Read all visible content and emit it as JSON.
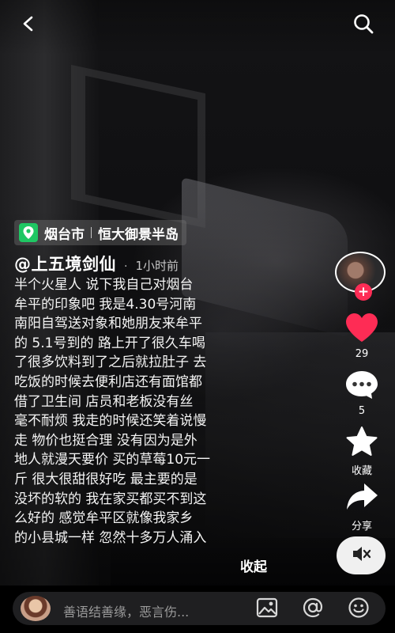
{
  "header": {
    "back_icon": "chevron-left-icon",
    "search_icon": "search-icon"
  },
  "location": {
    "icon": "map-pin-icon",
    "city": "烟台市",
    "place": "恒大御景半岛"
  },
  "post": {
    "author": "@上五境剑仙",
    "separator": "·",
    "time": "1小时前",
    "caption_lines": [
      "半个火星人 说下我自己对烟台",
      "牟平的印象吧  我是4.30号河南",
      "南阳自驾送对象和她朋友来牟平",
      "的 5.1号到的 路上开了很久车喝",
      "了很多饮料到了之后就拉肚子 去",
      "吃饭的时候去便利店还有面馆都",
      "借了卫生间  店员和老板没有丝",
      "毫不耐烦 我走的时候还笑着说慢",
      "走  物价也挺合理 没有因为是外",
      "地人就漫天要价 买的草莓10元一",
      "斤 很大很甜很好吃  最主要的是",
      "没坏的软的 我在家买都买不到这",
      "么好的  感觉牟平区就像我家乡",
      "的小县城一样 忽然十多万人涌入"
    ],
    "collapse_label": "收起"
  },
  "rail": {
    "follow_label": "+",
    "like_count": "29",
    "comment_count": "5",
    "favorite_label": "收藏",
    "share_label": "分享",
    "like_color": "#fe2c55"
  },
  "comment_bar": {
    "placeholder": "善语结善缘，恶言伤...",
    "image_icon": "image-icon",
    "mention_icon": "at-icon",
    "emoji_icon": "emoji-icon"
  }
}
